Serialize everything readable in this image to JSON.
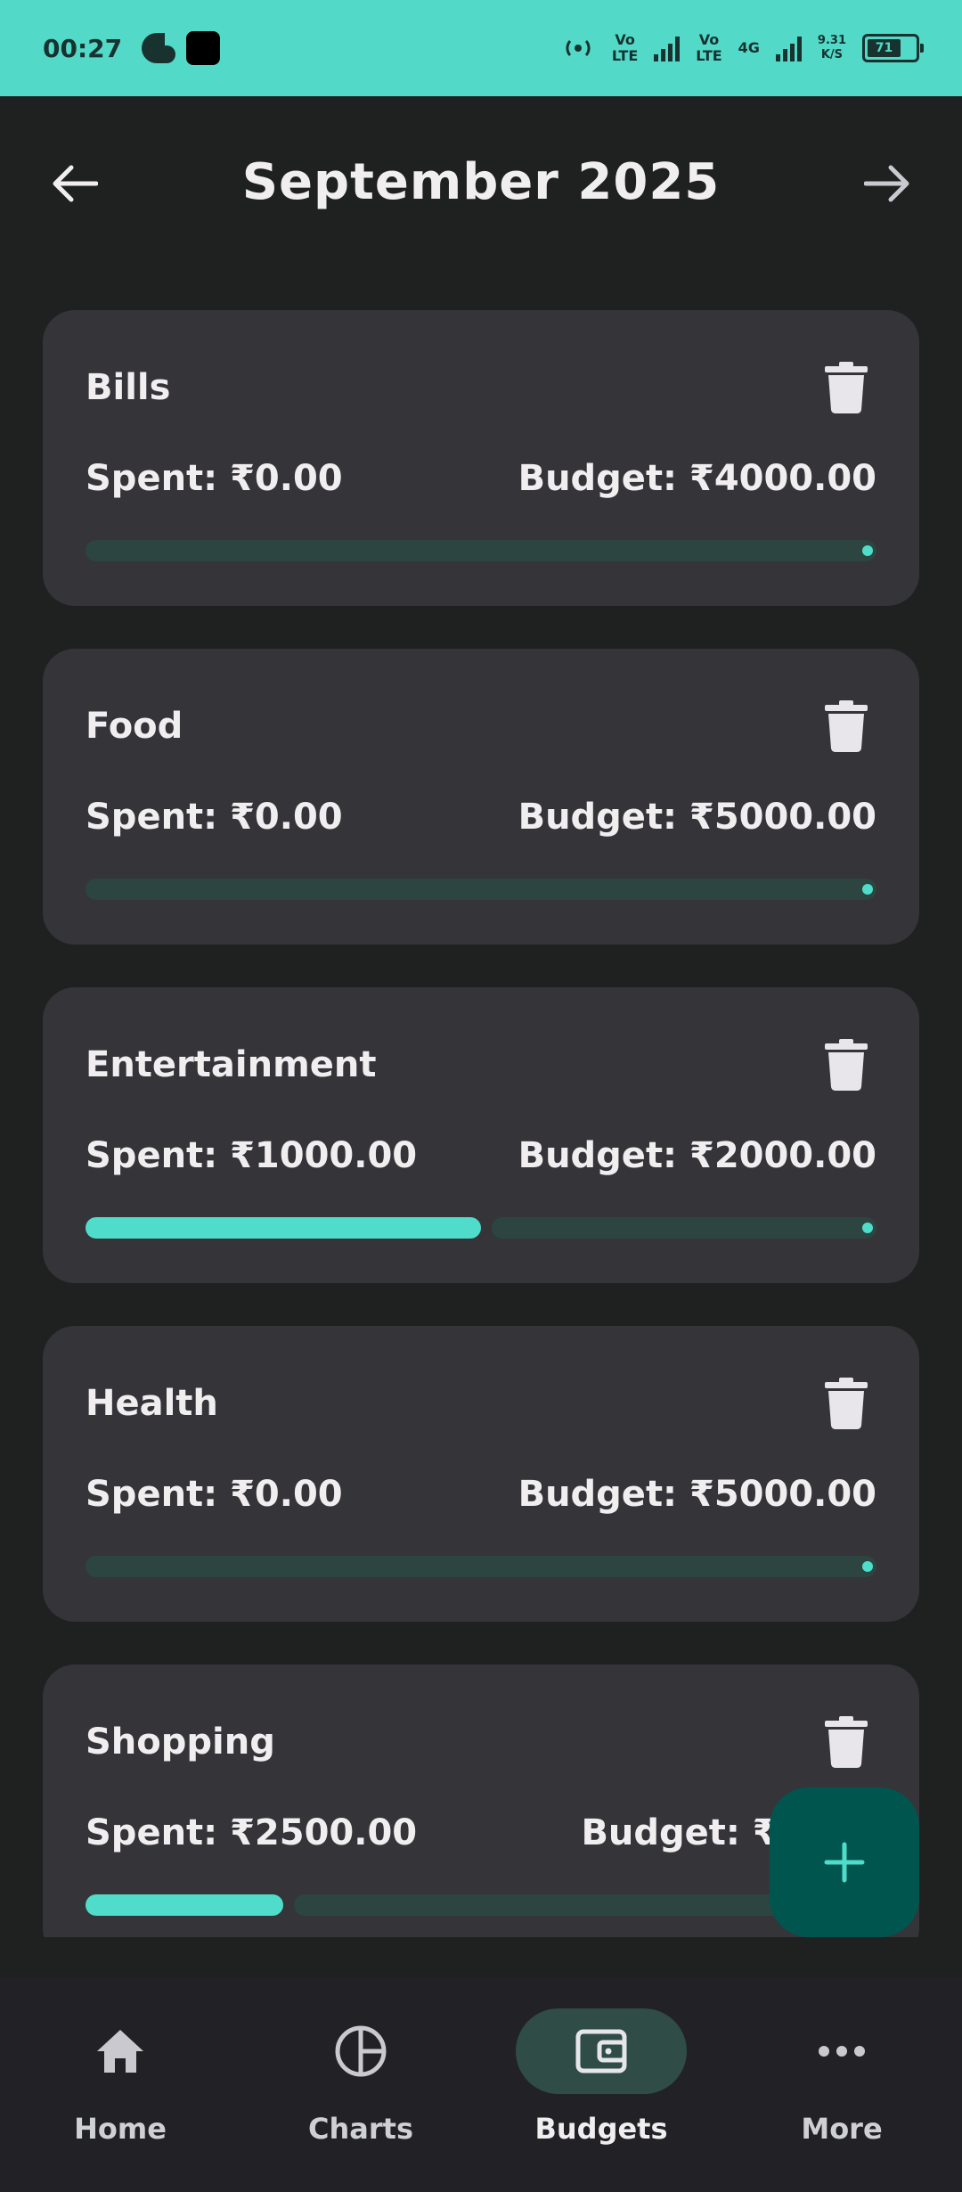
{
  "status_bar": {
    "time": "00:27",
    "net_lte1_top": "Vo",
    "net_lte1_bottom": "LTE",
    "net_lte2_top": "Vo",
    "net_lte2_bottom": "LTE",
    "net_4g": "4G",
    "speed_top": "9.31",
    "speed_bottom": "K/S",
    "battery": "71"
  },
  "header": {
    "title": "September 2025"
  },
  "budgets": [
    {
      "name": "Bills",
      "spent_text": "Spent: ₹0.00",
      "budget_text": "Budget: ₹4000.00",
      "spent": 0,
      "budget": 4000
    },
    {
      "name": "Food",
      "spent_text": "Spent: ₹0.00",
      "budget_text": "Budget: ₹5000.00",
      "spent": 0,
      "budget": 5000
    },
    {
      "name": "Entertainment",
      "spent_text": "Spent: ₹1000.00",
      "budget_text": "Budget: ₹2000.00",
      "spent": 1000,
      "budget": 2000
    },
    {
      "name": "Health",
      "spent_text": "Spent: ₹0.00",
      "budget_text": "Budget: ₹5000.00",
      "spent": 0,
      "budget": 5000
    },
    {
      "name": "Shopping",
      "spent_text": "Spent: ₹2500.00",
      "budget_text": "Budget: ₹1000",
      "spent": 2500,
      "budget": 10000
    }
  ],
  "fab": {
    "icon": "plus-icon"
  },
  "bottom_nav": [
    {
      "label": "Home",
      "icon": "home-icon",
      "active": false
    },
    {
      "label": "Charts",
      "icon": "pie-chart-icon",
      "active": false
    },
    {
      "label": "Budgets",
      "icon": "wallet-icon",
      "active": true
    },
    {
      "label": "More",
      "icon": "more-horizontal-icon",
      "active": false
    }
  ],
  "colors": {
    "accent": "#4fdcca",
    "status_bar": "#52d9c8",
    "background": "#1f2121",
    "card": "#353439",
    "track": "#2c4541",
    "fab": "#00564f"
  }
}
